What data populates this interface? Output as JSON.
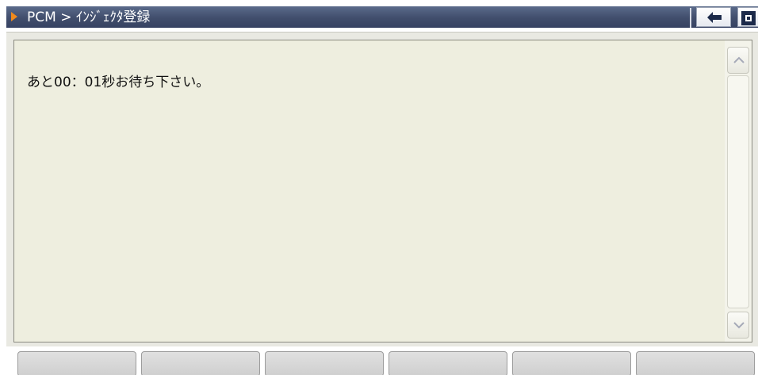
{
  "header": {
    "breadcrumb": "PCM > ｲﾝｼﾞｪｸﾀ登録",
    "icons": {
      "breadcrumb_arrow": "play-arrow-icon",
      "back": "back-arrow-icon",
      "settings": "gear-icon"
    }
  },
  "content": {
    "message": "あと00：01秒お待ち下さい。"
  },
  "scrollbar": {
    "up_icon": "chevron-up-icon",
    "down_icon": "chevron-down-icon"
  },
  "function_buttons": [
    {
      "label": ""
    },
    {
      "label": ""
    },
    {
      "label": ""
    },
    {
      "label": ""
    },
    {
      "label": ""
    },
    {
      "label": ""
    }
  ],
  "colors": {
    "title_bar": "#414e6c",
    "accent_arrow": "#f08a1c",
    "panel_bg": "#eeeedf"
  }
}
